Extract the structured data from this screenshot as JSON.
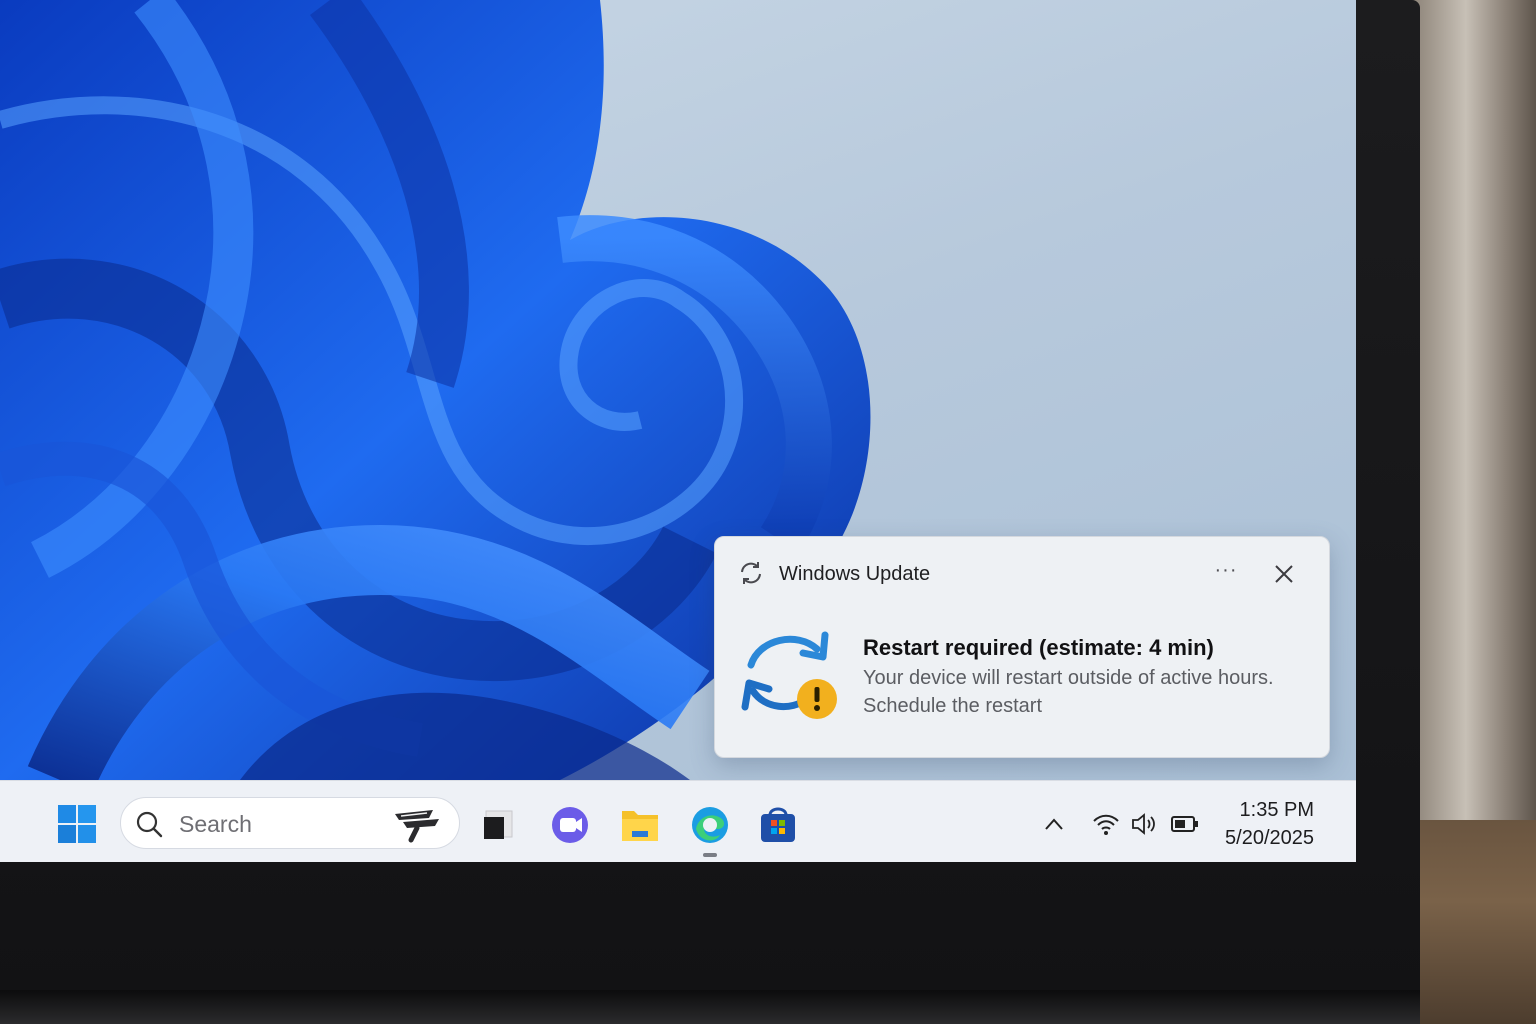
{
  "notification": {
    "app_name": "Windows Update",
    "app_icon": "sync-icon",
    "more_label": "···",
    "hero_icon": "update-warning-icon",
    "title": "Restart required (estimate: 4 min)",
    "body": "Your device will restart outside of active hours.",
    "action": "Schedule the restart",
    "accent_color": "#2b88d8",
    "warning_color": "#f2b01e"
  },
  "taskbar": {
    "search_placeholder": "Search",
    "apps": [
      "task-view-icon",
      "teams-icon",
      "file-explorer-icon",
      "edge-icon",
      "microsoft-store-icon"
    ],
    "tray": [
      "show-hidden-icons",
      "wifi-icon",
      "speaker-icon",
      "battery-icon"
    ]
  },
  "clock": {
    "time": "1:35 PM",
    "date": "5/20/2025"
  }
}
